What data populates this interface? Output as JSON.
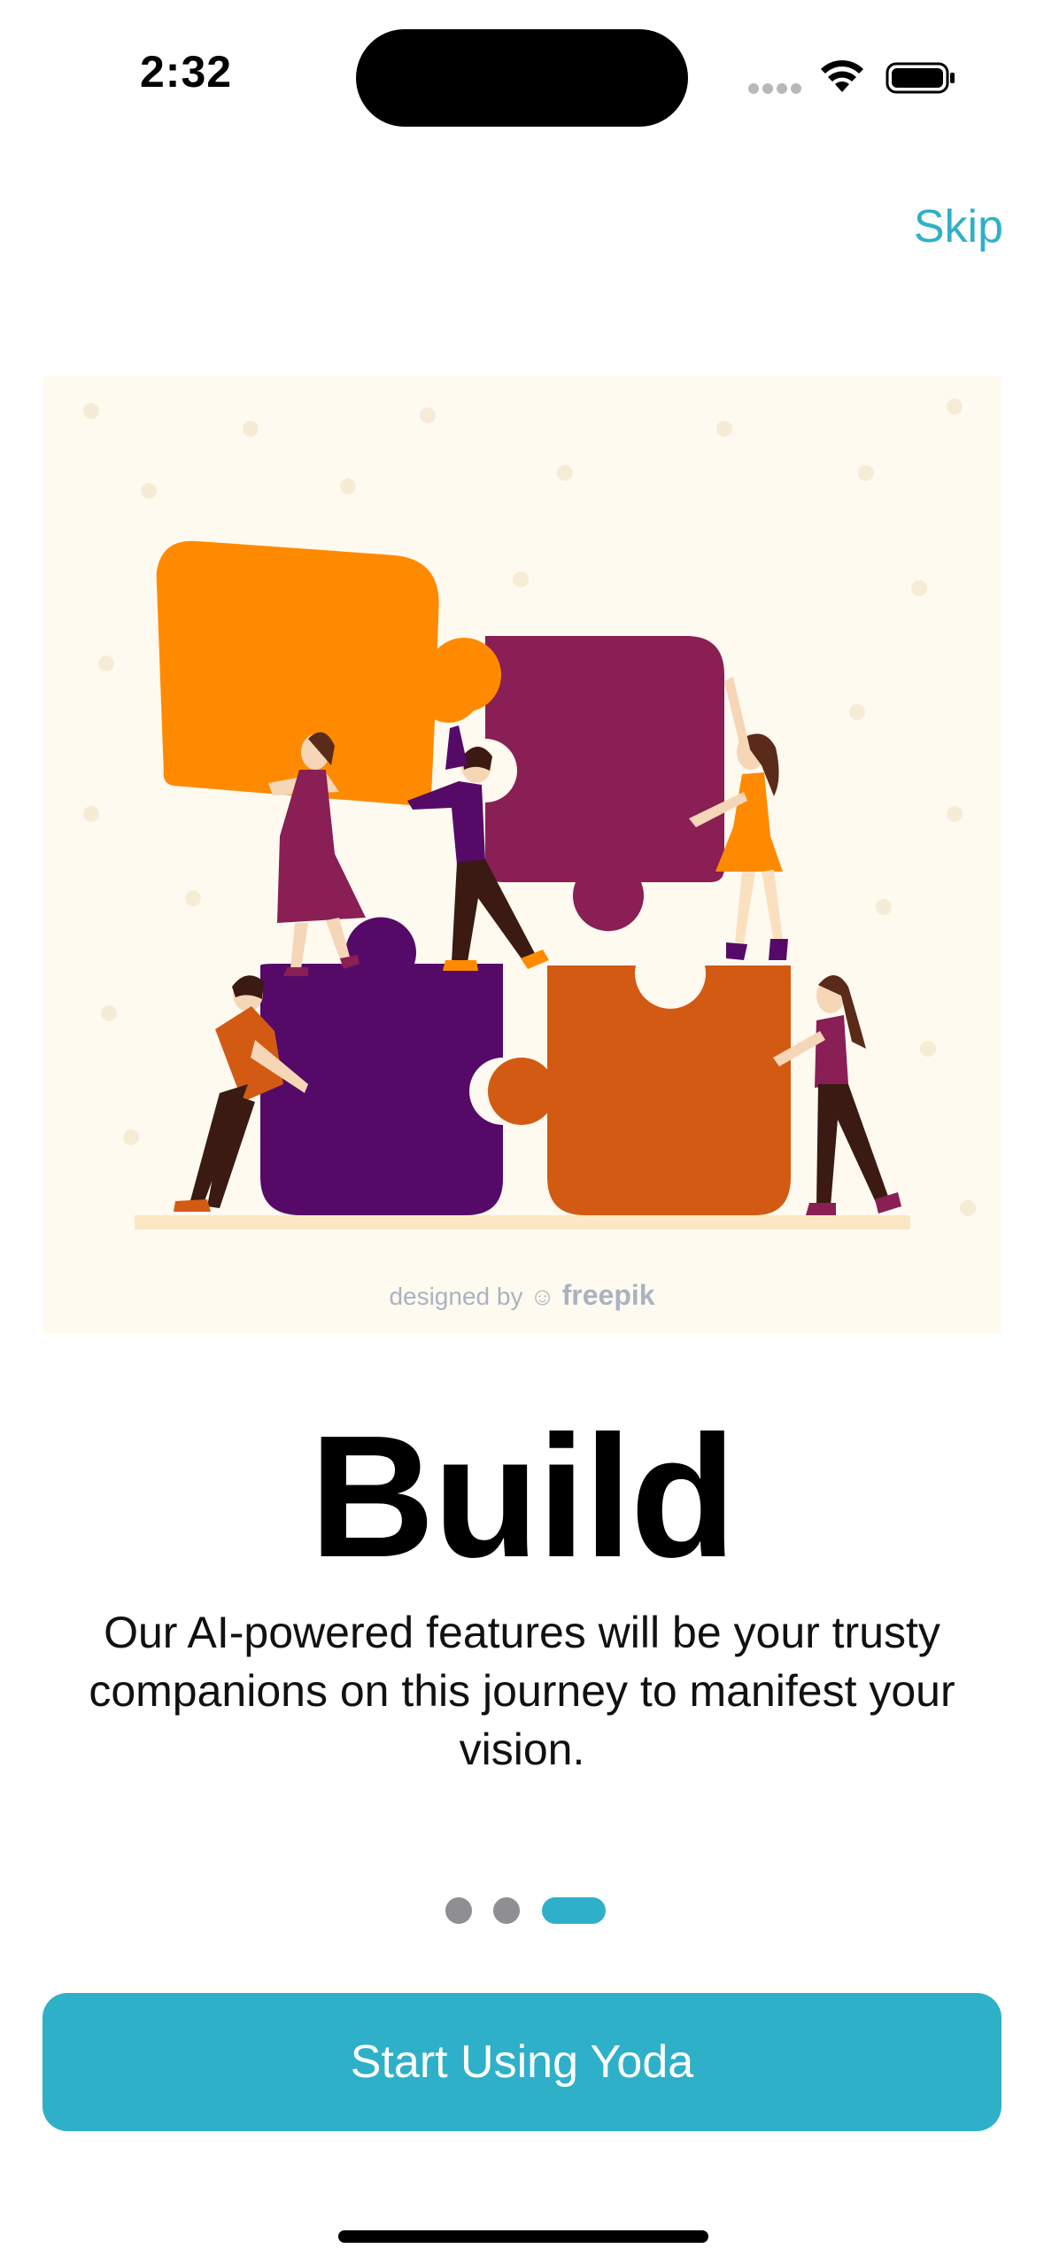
{
  "status_bar": {
    "time": "2:32",
    "icons": [
      "cellular-signal-icon",
      "wifi-icon",
      "battery-icon"
    ]
  },
  "header": {
    "skip_label": "Skip"
  },
  "illustration": {
    "description_icon": "puzzle-team-illustration",
    "credit_prefix": "designed by",
    "credit_brand": "freepik"
  },
  "onboarding": {
    "title": "Build",
    "description": "Our AI-powered features will be your trusty companions on this journey to manifest your vision.",
    "page_count": 3,
    "current_page": 3
  },
  "cta": {
    "label": "Start Using Yoda"
  },
  "colors": {
    "accent": "#2fb0c9",
    "inactive_dot": "#8e8e93",
    "illustration_bg": "#fffaf0"
  }
}
